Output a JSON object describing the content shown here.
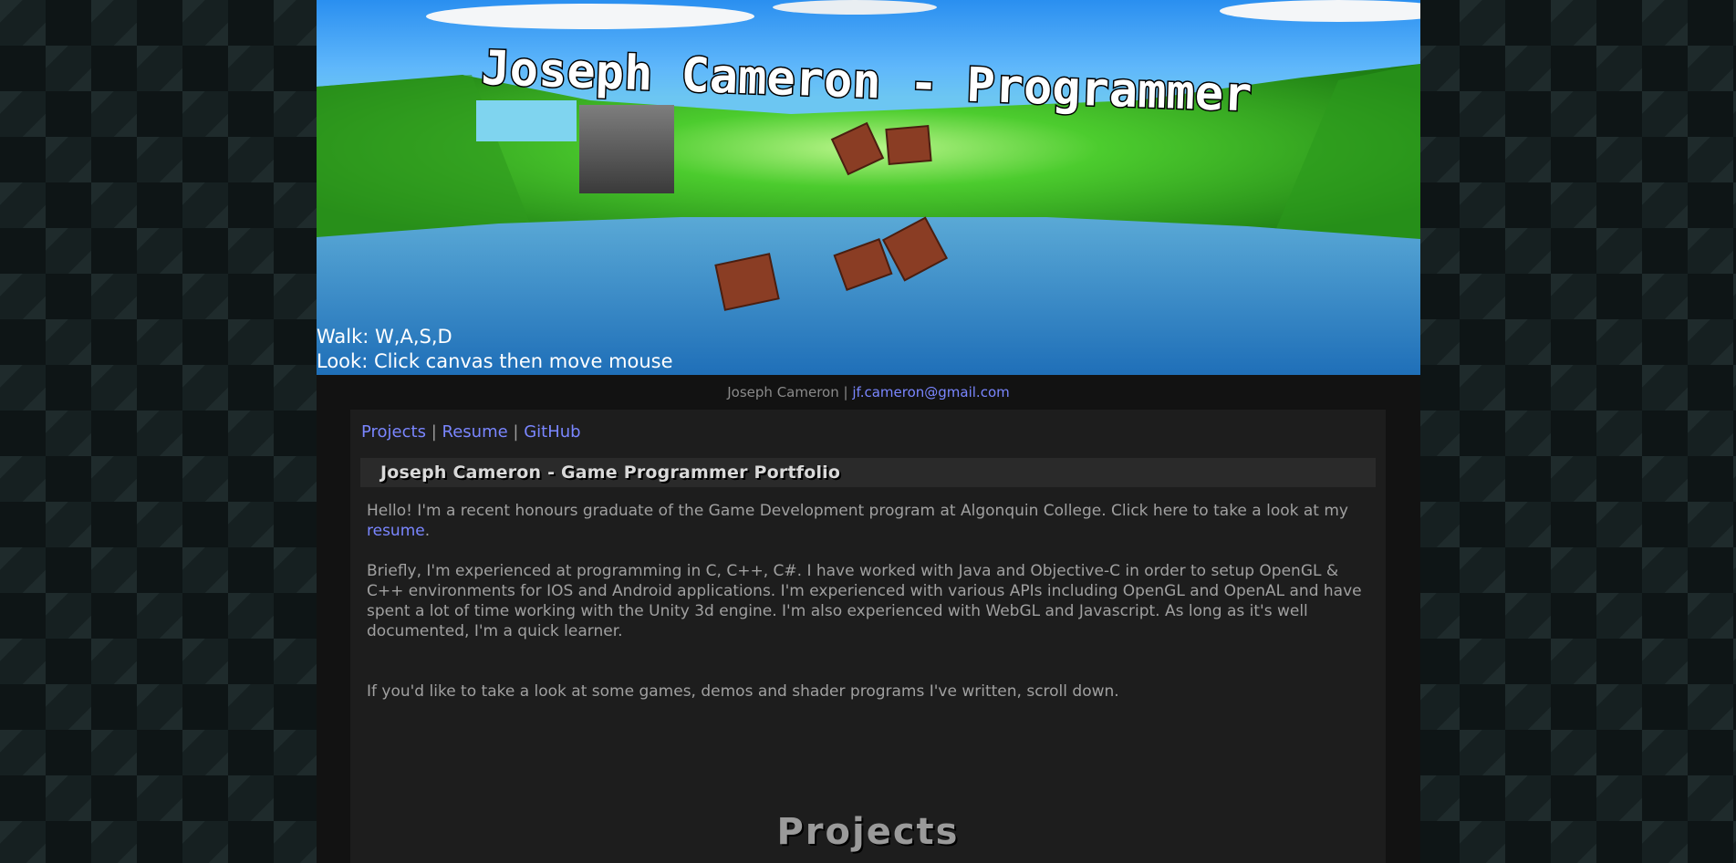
{
  "banner": {
    "title_art": "Joseph Cameron - Programmer",
    "help": {
      "walk": "Walk: W,A,S,D",
      "look": "Look: Click canvas then move mouse"
    }
  },
  "contact": {
    "name": "Joseph Cameron",
    "separator": "|",
    "email": "jf.cameron@gmail.com"
  },
  "nav": {
    "items": [
      {
        "label": "Projects"
      },
      {
        "label": "Resume"
      },
      {
        "label": "GitHub"
      }
    ],
    "separator": "|"
  },
  "section": {
    "title": "Joseph Cameron - Game Programmer Portfolio"
  },
  "intro": {
    "p1_text": "Hello! I'm a recent honours graduate of the Game Development program at Algonquin College. Click here to take a look at my ",
    "p1_link": "resume",
    "p1_end": ".",
    "p2": "Briefly, I'm experienced at programming in C, C++, C#. I have worked with Java and Objective-C in order to setup OpenGL & C++ environments for IOS and Android applications. I'm experienced with various APIs including OpenGL and OpenAL and have spent a lot of time working with the Unity 3d engine. I'm also experienced with WebGL and Javascript. As long as it's well documented, I'm a quick learner.",
    "p3": "If you'd like to take a look at some games, demos and shader programs I've written, scroll down."
  },
  "projects_heading": "Projects",
  "colors": {
    "link": "#7a86ff",
    "panel": "#1d1d1d",
    "text": "#a0a0a0"
  }
}
